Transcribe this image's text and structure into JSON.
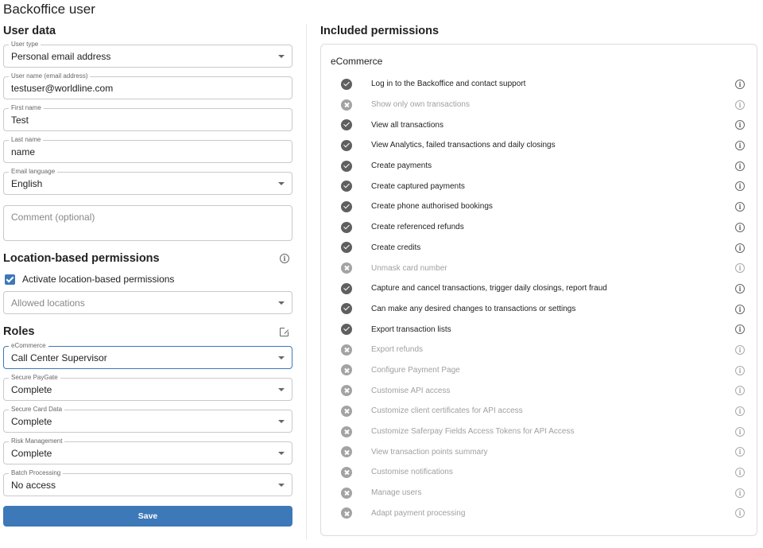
{
  "page_title": "Backoffice user",
  "user_data": {
    "title": "User data",
    "fields": [
      {
        "label": "User type",
        "value": "Personal email address",
        "type": "select"
      },
      {
        "label": "User name (email address)",
        "value": "testuser@worldline.com",
        "type": "text"
      },
      {
        "label": "First name",
        "value": "Test",
        "type": "text"
      },
      {
        "label": "Last name",
        "value": "name",
        "type": "text"
      },
      {
        "label": "Email language",
        "value": "English",
        "type": "select"
      }
    ],
    "comment_placeholder": "Comment (optional)"
  },
  "location": {
    "title": "Location-based permissions",
    "info_icon": "info-icon",
    "checkbox_label": "Activate location-based permissions",
    "checkbox_checked": true,
    "allowed_locations_placeholder": "Allowed locations"
  },
  "roles": {
    "title": "Roles",
    "open_icon": "open-in-new-icon",
    "fields": [
      {
        "label": "eCommerce",
        "value": "Call Center Supervisor",
        "focused": true
      },
      {
        "label": "Secure PayGate",
        "value": "Complete"
      },
      {
        "label": "Secure Card Data",
        "value": "Complete"
      },
      {
        "label": "Risk Management",
        "value": "Complete"
      },
      {
        "label": "Batch Processing",
        "value": "No access"
      }
    ]
  },
  "save_label": "Save",
  "permissions": {
    "title": "Included permissions",
    "card_title": "eCommerce",
    "accent_color": "#3d78b8",
    "items": [
      {
        "label": "Log in to the Backoffice and contact support",
        "granted": true
      },
      {
        "label": "Show only own transactions",
        "granted": false
      },
      {
        "label": "View all transactions",
        "granted": true
      },
      {
        "label": "View Analytics, failed transactions and daily closings",
        "granted": true
      },
      {
        "label": "Create payments",
        "granted": true
      },
      {
        "label": "Create captured payments",
        "granted": true
      },
      {
        "label": "Create phone authorised bookings",
        "granted": true
      },
      {
        "label": "Create referenced refunds",
        "granted": true
      },
      {
        "label": "Create credits",
        "granted": true
      },
      {
        "label": "Unmask card number",
        "granted": false
      },
      {
        "label": "Capture and cancel transactions, trigger daily closings, report fraud",
        "granted": true
      },
      {
        "label": "Can make any desired changes to transactions or settings",
        "granted": true
      },
      {
        "label": "Export transaction lists",
        "granted": true
      },
      {
        "label": "Export refunds",
        "granted": false
      },
      {
        "label": "Configure Payment Page",
        "granted": false
      },
      {
        "label": "Customise API access",
        "granted": false
      },
      {
        "label": "Customize client certificates for API access",
        "granted": false
      },
      {
        "label": "Customize Saferpay Fields Access Tokens for API Access",
        "granted": false
      },
      {
        "label": "View transaction points summary",
        "granted": false
      },
      {
        "label": "Customise notifications",
        "granted": false
      },
      {
        "label": "Manage users",
        "granted": false
      },
      {
        "label": "Adapt payment processing",
        "granted": false
      }
    ]
  }
}
